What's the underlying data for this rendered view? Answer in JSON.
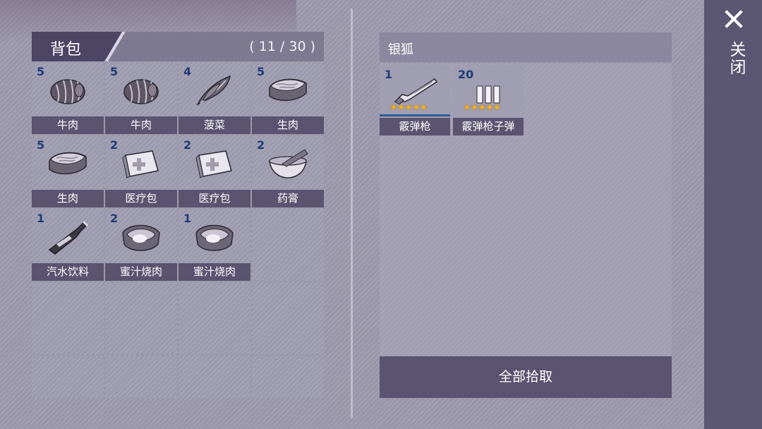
{
  "backpack": {
    "title": "背包",
    "count": "( 11 / 30 )",
    "items": [
      {
        "qty": "5",
        "name": "牛肉",
        "icon": "beef-icon"
      },
      {
        "qty": "5",
        "name": "牛肉",
        "icon": "beef-icon"
      },
      {
        "qty": "4",
        "name": "菠菜",
        "icon": "spinach-icon"
      },
      {
        "qty": "5",
        "name": "生肉",
        "icon": "raw-meat-icon"
      },
      {
        "qty": "5",
        "name": "生肉",
        "icon": "raw-meat-icon"
      },
      {
        "qty": "2",
        "name": "医疗包",
        "icon": "medkit-icon"
      },
      {
        "qty": "2",
        "name": "医疗包",
        "icon": "medkit-icon"
      },
      {
        "qty": "2",
        "name": "药膏",
        "icon": "ointment-icon"
      },
      {
        "qty": "1",
        "name": "汽水饮料",
        "icon": "soda-bottle-icon"
      },
      {
        "qty": "2",
        "name": "蜜汁烧肉",
        "icon": "honey-roast-icon"
      },
      {
        "qty": "1",
        "name": "蜜汁烧肉",
        "icon": "honey-roast-icon"
      }
    ]
  },
  "loot": {
    "title": "银狐",
    "items": [
      {
        "qty": "1",
        "name": "霰弹枪",
        "stars": "★★★★★",
        "icon": "shotgun-icon"
      },
      {
        "qty": "20",
        "name": "霰弹枪子弹",
        "stars": "★★★★★",
        "icon": "shotgun-shells-icon"
      }
    ],
    "pickup_all_label": "全部拾取"
  },
  "close_label": "关闭",
  "colors": {
    "panel_dark": "#5a5470",
    "quantity_text": "#1f3c78",
    "star": "#f2b222"
  }
}
